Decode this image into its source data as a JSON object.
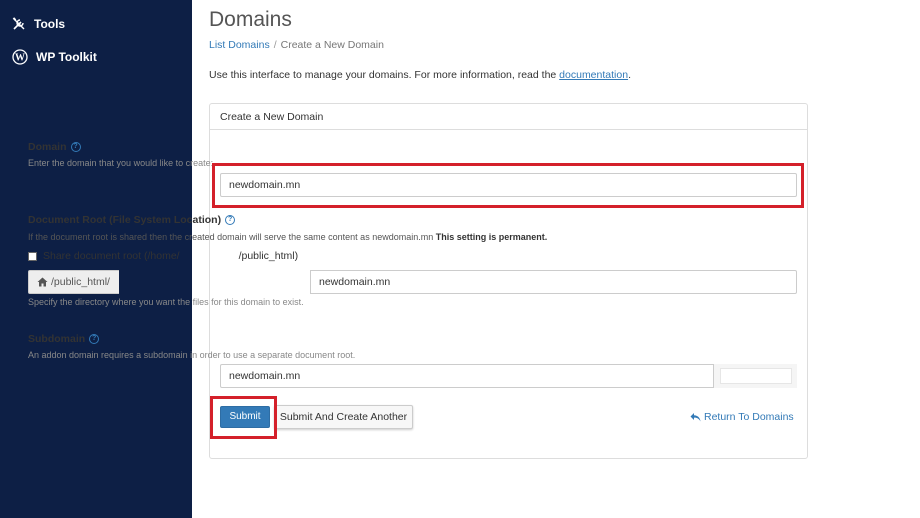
{
  "sidebar": {
    "items": [
      {
        "label": "Tools",
        "icon": "tools-icon"
      },
      {
        "label": "WP Toolkit",
        "icon": "wordpress-icon"
      }
    ]
  },
  "header": {
    "title": "Domains",
    "breadcrumb": [
      "List Domains",
      "Create a New Domain"
    ]
  },
  "intro": {
    "text": "Use this interface to manage your domains. For more information, read the ",
    "link": "documentation",
    "end": "."
  },
  "form": {
    "panel_title": "Create a New Domain",
    "domain": {
      "label": "Domain",
      "hint": "Enter the domain that you would like to create:",
      "value": "newdomain.mn"
    },
    "docroot": {
      "label": "Document Root (File System Location)",
      "hint_prefix": "If the document root is shared then the created domain will serve the same content as",
      "hint_domain": "newdomain.mn",
      "hint_bold": "This setting is permanent.",
      "share_label_start": "Share document root (/home/",
      "share_label_end": "/public_html)",
      "prefix": "/public_html/",
      "value": "newdomain.mn",
      "help": "Specify the directory where you want the files for this domain to exist."
    },
    "subdomain": {
      "label": "Subdomain",
      "hint": "An addon domain requires a subdomain in order to use a separate document root.",
      "value": "newdomain.mn"
    },
    "buttons": {
      "submit": "Submit",
      "submit_another": "Submit And Create Another",
      "return": "Return To Domains"
    }
  },
  "colors": {
    "sidebar_bg": "#0d1f45",
    "primary": "#337ab7",
    "highlight": "#d4202a"
  }
}
